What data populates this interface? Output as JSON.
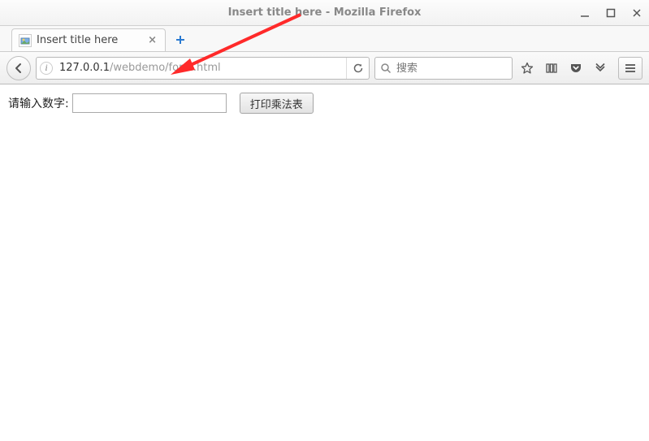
{
  "window": {
    "title": "Insert title here - Mozilla Firefox"
  },
  "tab": {
    "title": "Insert title here"
  },
  "url": {
    "host": "127.0.0.1",
    "path": "/webdemo/form.html"
  },
  "search": {
    "placeholder": "搜索"
  },
  "page": {
    "label": "请输入数字:",
    "button": "打印乘法表",
    "input_value": ""
  }
}
